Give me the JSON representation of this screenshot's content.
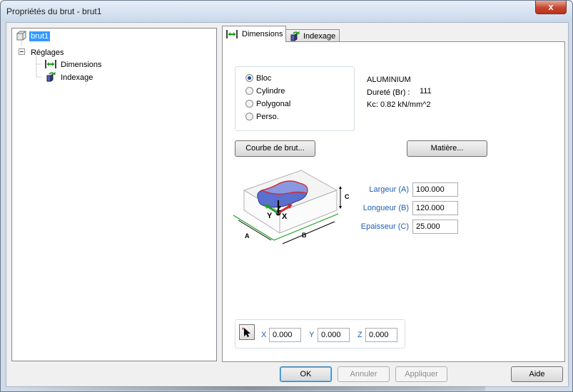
{
  "window": {
    "title": "Propriétés du brut - brut1",
    "close_glyph": "x"
  },
  "tree": {
    "root_label": "brut1",
    "group_label": "Réglages",
    "children": [
      {
        "label": "Dimensions"
      },
      {
        "label": "Indexage"
      }
    ]
  },
  "tabs": [
    {
      "label": "Dimensions"
    },
    {
      "label": "Indexage"
    }
  ],
  "shape": {
    "options": [
      {
        "label": "Bloc",
        "selected": true
      },
      {
        "label": "Cylindre",
        "selected": false
      },
      {
        "label": "Polygonal",
        "selected": false
      },
      {
        "label": "Perso.",
        "selected": false
      }
    ]
  },
  "material": {
    "name": "ALUMINIUM",
    "hardness_label": "Dureté (Br) :",
    "hardness_value": "111",
    "kc": "Kc: 0.82 kN/mm^2"
  },
  "buttons": {
    "curve": "Courbe de brut...",
    "material": "Matière...",
    "ok": "OK",
    "cancel": "Annuler",
    "apply": "Appliquer",
    "help": "Aide"
  },
  "diagram": {
    "label_a": "A",
    "label_b": "B",
    "label_c": "C",
    "axis_x": "X",
    "axis_y": "Y",
    "axis_z": "Z"
  },
  "dimensions": {
    "width_label": "Largeur (A)",
    "width_value": "100.000",
    "length_label": "Longueur (B)",
    "length_value": "120.000",
    "thickness_label": "Epaisseur (C)",
    "thickness_value": "25.000"
  },
  "origin": {
    "x_label": "X",
    "x_value": "0.000",
    "y_label": "Y",
    "y_value": "0.000",
    "z_label": "Z",
    "z_value": "0.000"
  },
  "colors": {
    "accent": "#3399ff",
    "label_blue": "#1e5fb4",
    "stock_blue": "#5a6fd0",
    "axis_green": "#1aa01a",
    "axis_red": "#d42a2a"
  }
}
